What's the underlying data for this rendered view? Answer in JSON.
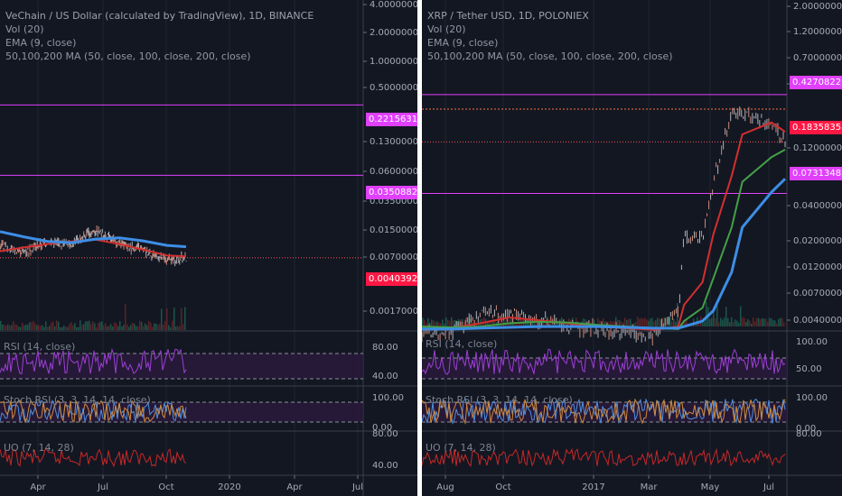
{
  "chart_data": [
    {
      "type": "line",
      "title": "VeChain / US Dollar (calculated by TradingView), 1D, BINANCE",
      "indicators": [
        "Vol (20)",
        "EMA (9, close)",
        "50,100,200 MA (50, close, 100, close, 200, close)"
      ],
      "price_scale": "log",
      "price_axis_labels": [
        "4.00000000",
        "2.00000000",
        "1.00000000",
        "0.50000000",
        "0.13000000",
        "0.06000000",
        "0.03500000",
        "0.01500000",
        "0.00700000",
        "0.00170000"
      ],
      "x_tick_labels": [
        "Apr",
        "Jul",
        "Oct",
        "2020",
        "Apr",
        "Jul"
      ],
      "x": [
        "2019-03",
        "2019-04",
        "2019-05",
        "2019-06",
        "2019-07",
        "2019-08",
        "2019-09",
        "2019-10",
        "2019-10-25"
      ],
      "series": [
        {
          "values": [
            0.0055,
            0.0048,
            0.0062,
            0.0058,
            0.0085,
            0.0058,
            0.005,
            0.0038,
            0.004
          ]
        },
        {
          "values": [
            0.0048,
            0.0053,
            0.0058,
            0.0062,
            0.0065,
            0.0058,
            0.005,
            0.0043,
            0.0042
          ]
        },
        {
          "values": [
            0.008,
            0.007,
            0.0062,
            0.006,
            0.0066,
            0.0068,
            0.0063,
            0.0056,
            0.0054
          ]
        }
      ],
      "horizontal_levels": [
        0.22156319,
        0.03508828
      ],
      "current_price": 0.0040392,
      "price_tags": [
        "0.22156319",
        "0.03508828",
        "0.00403920"
      ],
      "rsi": {
        "label": "RSI (14, close)",
        "axis": [
          "80.00",
          "40.00"
        ]
      },
      "stoch_rsi": {
        "label": "Stoch RSI (3, 3, 14, 14, close)",
        "axis": [
          "100.00",
          "0.00"
        ]
      },
      "uo": {
        "label": "UO (7, 14, 28)",
        "axis": [
          "80.00",
          "40.00"
        ]
      }
    },
    {
      "type": "line",
      "title": "XRP / Tether USD, 1D, POLONIEX",
      "indicators": [
        "Vol (20)",
        "EMA (9, close)",
        "50,100,200 MA (50, close, 100, close, 200, close)"
      ],
      "price_scale": "log",
      "price_axis_labels": [
        "2.00000000",
        "1.20000000",
        "0.70000000",
        "0.40000000",
        "0.12000000",
        "0.04000000",
        "0.02000000",
        "0.01200000",
        "0.00700000",
        "0.00400000"
      ],
      "x_tick_labels": [
        "Aug",
        "Oct",
        "2017",
        "Mar",
        "May",
        "Jul"
      ],
      "x": [
        "2016-07",
        "2016-08",
        "2016-09",
        "2016-10",
        "2016-11",
        "2016-12",
        "2017-01",
        "2017-02",
        "2017-03",
        "2017-03-25",
        "2017-04",
        "2017-04-20",
        "2017-05",
        "2017-05-20",
        "2017-06",
        "2017-07",
        "2017-07-15"
      ],
      "series": [
        {
          "values": [
            0.006,
            0.006,
            0.0085,
            0.0085,
            0.0075,
            0.0068,
            0.0065,
            0.0062,
            0.006,
            0.009,
            0.033,
            0.034,
            0.09,
            0.33,
            0.3,
            0.25,
            0.184
          ]
        },
        {
          "values": [
            0.0065,
            0.0066,
            0.0072,
            0.008,
            0.0076,
            0.0072,
            0.0068,
            0.0066,
            0.0064,
            0.0068,
            0.01,
            0.015,
            0.035,
            0.1,
            0.21,
            0.26,
            0.22
          ]
        },
        {
          "values": [
            0.0068,
            0.0067,
            0.0068,
            0.0072,
            0.0074,
            0.0073,
            0.007,
            0.0068,
            0.0066,
            0.0065,
            0.0075,
            0.0095,
            0.016,
            0.04,
            0.09,
            0.14,
            0.16
          ]
        },
        {
          "values": [
            0.0065,
            0.0065,
            0.0066,
            0.0067,
            0.0068,
            0.0068,
            0.0068,
            0.0067,
            0.0066,
            0.0066,
            0.0068,
            0.0075,
            0.009,
            0.018,
            0.04,
            0.075,
            0.095
          ]
        }
      ],
      "horizontal_levels": [
        0.42708226,
        0.07313483,
        0.33
      ],
      "current_price": 0.18358358,
      "price_tags": [
        "0.42708226",
        "0.18358358",
        "0.07313483"
      ],
      "rsi": {
        "label": "RSI (14, close)",
        "axis": [
          "100.00",
          "50.00"
        ]
      },
      "stoch_rsi": {
        "label": "Stoch RSI (3, 3, 14, 14, close)",
        "axis": [
          "100.00",
          "0.00"
        ]
      },
      "uo": {
        "label": "UO (7, 14, 28)",
        "axis": [
          "80.00"
        ]
      }
    }
  ],
  "colors": {
    "background": "#131722",
    "level_line": "#e040fb",
    "price_tag": "#ff1744",
    "ma_red": "#d32f2f",
    "ma_green": "#43a047",
    "ma_blue": "#3d8ee6",
    "rsi_line": "#9c3fd4",
    "uo_line": "#c62828"
  }
}
